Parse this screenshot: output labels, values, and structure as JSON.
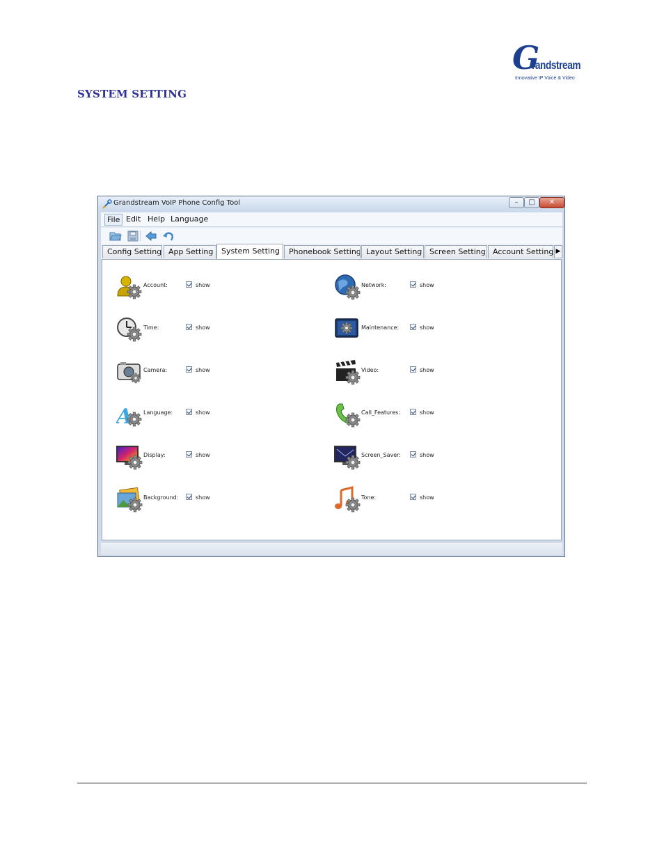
{
  "header": {
    "logo": {
      "mark": "G",
      "word": "randstream",
      "tagline": "Innovative IP Voice & Video"
    },
    "section_title": "SYSTEM SETTING"
  },
  "window": {
    "title": "Grandstream VoIP Phone Config Tool",
    "controls": {
      "minimize": "–",
      "maximize": "□",
      "close": "✕"
    },
    "menu": {
      "file": "File",
      "edit": "Edit",
      "help": "Help",
      "language": "Language"
    },
    "toolbar": [
      "open-folder-icon",
      "save-icon",
      "back-arrow-icon",
      "undo-icon"
    ],
    "tabs": {
      "config": "Config Setting",
      "app": "App Setting",
      "system": "System Setting",
      "phonebook": "Phonebook Setting",
      "layout": "Layout Setting",
      "screen": "Screen Setting",
      "account": "Account Setting",
      "scroll": "▶",
      "active": "System Setting"
    },
    "items": {
      "account": {
        "label": "Account:",
        "show": "show",
        "checked": true,
        "icon": "account-icon"
      },
      "network": {
        "label": "Network:",
        "show": "show",
        "checked": true,
        "icon": "network-icon"
      },
      "time": {
        "label": "Time:",
        "show": "show",
        "checked": true,
        "icon": "time-icon"
      },
      "maintenance": {
        "label": "Maintenance:",
        "show": "show",
        "checked": true,
        "icon": "maintenance-icon"
      },
      "camera": {
        "label": "Camera:",
        "show": "show",
        "checked": true,
        "icon": "camera-icon"
      },
      "video": {
        "label": "Video:",
        "show": "show",
        "checked": true,
        "icon": "video-icon"
      },
      "language": {
        "label": "Language:",
        "show": "show",
        "checked": true,
        "icon": "language-icon"
      },
      "call_features": {
        "label": "Call_Features:",
        "show": "show",
        "checked": true,
        "icon": "call-features-icon"
      },
      "display": {
        "label": "Display:",
        "show": "show",
        "checked": true,
        "icon": "display-icon"
      },
      "screen_saver": {
        "label": "Screen_Saver:",
        "show": "show",
        "checked": true,
        "icon": "screen-saver-icon"
      },
      "background": {
        "label": "Background:",
        "show": "show",
        "checked": true,
        "icon": "background-icon"
      },
      "tone": {
        "label": "Tone:",
        "show": "show",
        "checked": true,
        "icon": "tone-icon"
      }
    }
  },
  "colors": {
    "brand": "#1d3f8f",
    "heading": "#2e3192"
  }
}
